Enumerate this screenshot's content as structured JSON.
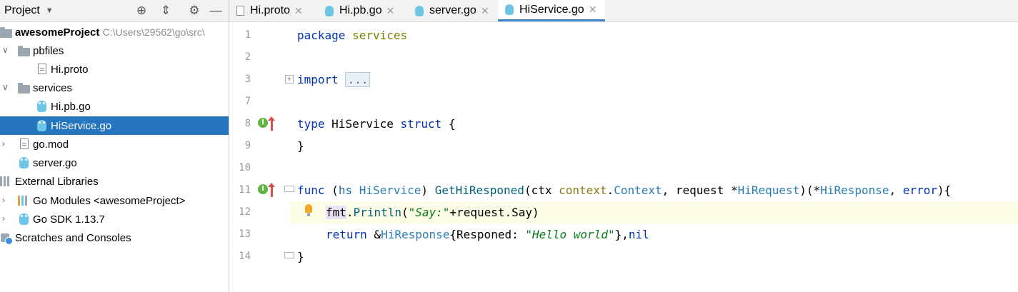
{
  "project_panel": {
    "title": "Project",
    "tree": [
      {
        "label": "awesomeProject",
        "path": "C:\\Users\\29562\\go\\src\\"
      },
      {
        "label": "pbfiles"
      },
      {
        "label": "Hi.proto"
      },
      {
        "label": "services"
      },
      {
        "label": "Hi.pb.go"
      },
      {
        "label": "HiService.go",
        "selected": true
      },
      {
        "label": "go.mod"
      },
      {
        "label": "server.go"
      },
      {
        "label": "External Libraries"
      },
      {
        "label": "Go Modules <awesomeProject>"
      },
      {
        "label": "Go SDK 1.13.7"
      },
      {
        "label": "Scratches and Consoles"
      }
    ]
  },
  "tabs": [
    {
      "label": "Hi.proto"
    },
    {
      "label": "Hi.pb.go"
    },
    {
      "label": "server.go"
    },
    {
      "label": "HiService.go",
      "active": true
    }
  ],
  "editor": {
    "line_numbers": [
      "1",
      "2",
      "3",
      "7",
      "8",
      "9",
      "10",
      "11",
      "12",
      "13",
      "14"
    ],
    "code": {
      "l1_kw": "package",
      "l1_pkg": "services",
      "l3_kw": "import",
      "l3_folded": "...",
      "l8_kw1": "type",
      "l8_name": "HiService",
      "l8_kw2": "struct",
      "l8_brace": "{",
      "l9": "}",
      "l11_kw": "func",
      "l11_p1": "(",
      "l11_recv": "hs",
      "l11_recvtype": "HiService",
      "l11_p2": ")",
      "l11_fn": "GetHiResponed",
      "l11_p3": "(ctx ",
      "l11_ctxpkg": "context",
      "l11_dot": ".",
      "l11_ctxtype": "Context",
      "l11_p4": ", request *",
      "l11_reqtype": "HiRequest",
      "l11_p5": ")(*",
      "l11_resptype": "HiResponse",
      "l11_p6": ", ",
      "l11_err": "error",
      "l11_p7": "){",
      "l12_fmt": "fmt",
      "l12_dot": ".",
      "l12_fn": "Println",
      "l12_p1": "(",
      "l12_str": "\"Say:\"",
      "l12_p2": "+request.Say)",
      "l13_kw": "return",
      "l13_amp": " &",
      "l13_type": "HiResponse",
      "l13_p1": "{Responed: ",
      "l13_str": "\"Hello world\"",
      "l13_p2": "},",
      "l13_nil": "nil",
      "l14": "}"
    }
  },
  "icons": {
    "locate": "crosshair-icon",
    "collapse": "collapse-icon",
    "settings": "gear-icon",
    "hide": "minimize-icon"
  },
  "colors": {
    "selection": "#2675bf",
    "keyword": "#0033b3",
    "string": "#067d17",
    "current_line": "#fdfce6"
  }
}
